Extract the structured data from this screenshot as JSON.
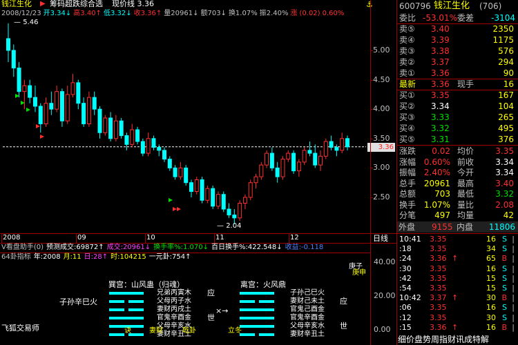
{
  "header": {
    "stock": "钱江生化",
    "indicator": "筹码超跌综合选",
    "price_label": "现价线 3.36",
    "bar_items": [
      {
        "t": "2008/12/23",
        "c": "#c0c0c0"
      },
      {
        "t": "开3.34↓",
        "c": "#00ffff"
      },
      {
        "t": "高3.40↑",
        "c": "#ff3030"
      },
      {
        "t": "低3.32↓",
        "c": "#00ffff"
      },
      {
        "t": "收3.36↑",
        "c": "#ff3030"
      },
      {
        "t": "量20961↓",
        "c": "#c0c0c0"
      },
      {
        "t": "额703↓",
        "c": "#c0c0c0"
      },
      {
        "t": "换1.07%",
        "c": "#c0c0c0"
      },
      {
        "t": "振2.40%",
        "c": "#c0c0c0"
      },
      {
        "t": "涨",
        "c": "#ff3030"
      },
      {
        "t": "(0.02)",
        "c": "#ff3030"
      },
      {
        "t": "0.60%",
        "c": "#ff3030"
      }
    ]
  },
  "chart": {
    "y_ticks": [
      "5.00",
      "4.50",
      "4.00",
      "3.50",
      "3.00",
      "2.50"
    ],
    "months": [
      "2008",
      "09",
      "10",
      "11",
      "12"
    ],
    "high_label": "5.46",
    "low_label": "2.04",
    "current_price": "3.36"
  },
  "chart_data": {
    "type": "candlestick",
    "period": "2008/08 – 2008/12",
    "x_axis_labels": [
      "2008",
      "09",
      "10",
      "11",
      "12"
    ],
    "y_axis_ticks": [
      2.5,
      3.0,
      3.5,
      4.0,
      4.5,
      5.0
    ],
    "annotations": {
      "high": 5.46,
      "low": 2.04,
      "current_price_line": 3.36
    },
    "ohlc": [
      [
        5.2,
        5.46,
        4.8,
        5.0
      ],
      [
        5.0,
        5.1,
        4.55,
        4.7
      ],
      [
        4.7,
        4.8,
        4.2,
        4.3
      ],
      [
        4.3,
        4.5,
        4.0,
        4.4
      ],
      [
        4.4,
        4.5,
        4.1,
        4.2
      ],
      [
        4.2,
        4.4,
        3.95,
        4.05
      ],
      [
        4.05,
        4.1,
        3.6,
        3.75
      ],
      [
        3.75,
        4.2,
        3.7,
        4.1
      ],
      [
        4.1,
        4.3,
        3.9,
        4.0
      ],
      [
        4.0,
        4.4,
        3.95,
        4.3
      ],
      [
        4.3,
        4.35,
        3.7,
        3.8
      ],
      [
        3.8,
        4.4,
        3.75,
        4.25
      ],
      [
        4.25,
        4.6,
        4.2,
        4.45
      ],
      [
        4.45,
        4.5,
        4.0,
        4.1
      ],
      [
        4.1,
        4.2,
        3.7,
        3.75
      ],
      [
        3.75,
        4.3,
        3.7,
        4.2
      ],
      [
        4.2,
        4.3,
        3.9,
        4.0
      ],
      [
        4.0,
        4.05,
        3.5,
        3.6
      ],
      [
        3.6,
        3.9,
        3.55,
        3.85
      ],
      [
        3.85,
        3.95,
        3.45,
        3.5
      ],
      [
        3.5,
        3.9,
        3.45,
        3.8
      ],
      [
        3.8,
        3.85,
        3.5,
        3.55
      ],
      [
        3.55,
        3.6,
        3.3,
        3.4
      ],
      [
        3.4,
        3.75,
        3.35,
        3.65
      ],
      [
        3.65,
        3.7,
        3.4,
        3.45
      ],
      [
        3.45,
        3.5,
        3.2,
        3.25
      ],
      [
        3.25,
        3.6,
        3.2,
        3.5
      ],
      [
        3.5,
        3.55,
        3.3,
        3.35
      ],
      [
        3.35,
        3.4,
        3.2,
        3.3
      ],
      [
        3.3,
        3.35,
        3.1,
        3.15
      ],
      [
        3.15,
        3.2,
        2.95,
        3.0
      ],
      [
        3.0,
        3.05,
        2.8,
        2.85
      ],
      [
        2.85,
        3.1,
        2.8,
        3.0
      ],
      [
        3.0,
        3.05,
        2.7,
        2.75
      ],
      [
        2.75,
        2.8,
        2.5,
        2.6
      ],
      [
        2.6,
        2.85,
        2.55,
        2.8
      ],
      [
        2.8,
        2.85,
        2.4,
        2.45
      ],
      [
        2.45,
        2.7,
        2.4,
        2.65
      ],
      [
        2.65,
        2.7,
        2.3,
        2.35
      ],
      [
        2.35,
        2.6,
        2.3,
        2.55
      ],
      [
        2.55,
        2.6,
        2.25,
        2.3
      ],
      [
        2.3,
        2.4,
        2.15,
        2.2
      ],
      [
        2.2,
        2.3,
        2.04,
        2.15
      ],
      [
        2.15,
        2.45,
        2.1,
        2.4
      ],
      [
        2.4,
        2.55,
        2.3,
        2.5
      ],
      [
        2.5,
        2.8,
        2.45,
        2.75
      ],
      [
        2.75,
        2.9,
        2.65,
        2.85
      ],
      [
        2.85,
        3.1,
        2.8,
        3.05
      ],
      [
        3.05,
        3.3,
        3.0,
        3.25
      ],
      [
        3.25,
        3.35,
        2.95,
        3.0
      ],
      [
        3.0,
        3.1,
        2.75,
        2.85
      ],
      [
        2.85,
        3.2,
        2.8,
        3.15
      ],
      [
        3.15,
        3.3,
        3.1,
        3.25
      ],
      [
        3.25,
        3.3,
        2.9,
        2.95
      ],
      [
        2.95,
        3.15,
        2.85,
        3.1
      ],
      [
        3.1,
        3.35,
        3.05,
        3.3
      ],
      [
        3.3,
        3.45,
        3.2,
        3.25
      ],
      [
        3.25,
        3.4,
        3.0,
        3.05
      ],
      [
        3.05,
        3.3,
        2.95,
        3.2
      ],
      [
        3.2,
        3.5,
        3.15,
        3.45
      ],
      [
        3.45,
        3.55,
        3.3,
        3.35
      ],
      [
        3.35,
        3.4,
        3.2,
        3.3
      ],
      [
        3.3,
        3.6,
        3.25,
        3.5
      ],
      [
        3.5,
        3.55,
        3.3,
        3.36
      ]
    ]
  },
  "indicator_row": {
    "title": "V看盘助手(0)",
    "items": [
      {
        "t": "预测成交:69872↑",
        "c": "#ffffff"
      },
      {
        "t": "成交:20961↓",
        "c": "#ff40ff"
      },
      {
        "t": "换手率%:1.070↓",
        "c": "#00e000"
      },
      {
        "t": "百日换手%:422.548↓",
        "c": "#ffffff"
      },
      {
        "t": "收益:-0.118",
        "c": "#5080ff"
      }
    ]
  },
  "gua_row": {
    "title": "64卦指标",
    "items": [
      {
        "t": "年:2008",
        "c": "#ffffff"
      },
      {
        "t": "月:11",
        "c": "#ffff00"
      },
      {
        "t": "日:28↑",
        "c": "#ff40ff"
      },
      {
        "t": "时:104215",
        "c": "#ffff00"
      },
      {
        "t": "一元卦:754↑",
        "c": "#ffffff"
      }
    ],
    "y_ticks": [
      "40.00",
      "20.00",
      "0.00"
    ],
    "left_gua": {
      "title": "巽宫：山风蛊（归魂）",
      "lines": [
        "兄弟丙寅木",
        "父母丙子水",
        "妻财丙戌土",
        "官鬼辛酉金",
        "父母辛亥水",
        "妻财辛丑土"
      ],
      "yao_yin": [
        false,
        true,
        true,
        false,
        false,
        true
      ],
      "marks": [
        "应",
        "",
        "",
        "世",
        "",
        ""
      ],
      "side": "子孙辛巳火"
    },
    "right_gua": {
      "title": "离宫：火风鼎",
      "lines": [
        "子孙己巳火",
        "妻财己未土",
        "官鬼己酉金",
        "官鬼辛酉金",
        "父母辛亥水",
        "妻财辛丑土"
      ],
      "yao_yin": [
        false,
        true,
        false,
        false,
        false,
        true
      ],
      "marks": [
        "",
        "应",
        "",
        "",
        "世",
        ""
      ]
    },
    "arrow": "×→",
    "bottom_labels": [
      "诀",
      "妻财",
      "乾卦",
      "立冬"
    ],
    "side_text": [
      "庚子",
      "庚申"
    ],
    "author": "飞狐交易师"
  },
  "extra_label": "日线",
  "quote": {
    "code": "600796",
    "name": "钱江生化",
    "rank": "(706)",
    "weibi_label": "委比",
    "weibi": "-53.01%",
    "weicha_label": "委差",
    "weicha": "-3104",
    "sells": [
      {
        "label": "卖⑤",
        "price": "3.40",
        "vol": "2350"
      },
      {
        "label": "卖④",
        "price": "3.39",
        "vol": "1175"
      },
      {
        "label": "卖③",
        "price": "3.38",
        "vol": "576"
      },
      {
        "label": "卖②",
        "price": "3.37",
        "vol": "294"
      },
      {
        "label": "卖①",
        "price": "3.36",
        "vol": "90"
      }
    ],
    "latest_label": "最新",
    "latest": "3.36",
    "now_hand_label": "现手",
    "now_hand": "16",
    "buys": [
      {
        "label": "买①",
        "price": "3.35",
        "vol": "167"
      },
      {
        "label": "买②",
        "price": "3.34",
        "vol": "104"
      },
      {
        "label": "买③",
        "price": "3.33",
        "vol": "265"
      },
      {
        "label": "买④",
        "price": "3.32",
        "vol": "495"
      },
      {
        "label": "买⑤",
        "price": "3.31",
        "vol": "376"
      }
    ],
    "stats": [
      [
        "涨跌",
        "0.02",
        "均价",
        "3.35"
      ],
      [
        "涨幅",
        "0.60%",
        "前收",
        "3.34"
      ],
      [
        "振幅",
        "2.40%",
        "今开",
        "3.34"
      ],
      [
        "总手",
        "20961",
        "最高",
        "3.40"
      ],
      [
        "总额",
        "703",
        "最低",
        "3.32"
      ],
      [
        "换手",
        "1.07%",
        "量比",
        "2.08"
      ],
      [
        "分笔",
        "497",
        "均量",
        "42"
      ]
    ],
    "outer_label": "外盘",
    "outer": "9155",
    "inner_label": "内盘",
    "inner": "11806",
    "ticks": [
      {
        "time": "10:41",
        "price": "3.35",
        "arrow": "",
        "vol": "16",
        "bs": "S"
      },
      {
        "time": ":18",
        "price": "3.35",
        "arrow": "",
        "vol": "34",
        "bs": "S"
      },
      {
        "time": ":24",
        "price": "3.36",
        "arrow": "↑",
        "vol": "65",
        "bs": "B"
      },
      {
        "time": ":30",
        "price": "3.35",
        "arrow": "",
        "vol": "16",
        "bs": "S"
      },
      {
        "time": ":42",
        "price": "3.35",
        "arrow": "",
        "vol": "15",
        "bs": "S"
      },
      {
        "time": ":54",
        "price": "3.35",
        "arrow": "",
        "vol": "15",
        "bs": "S"
      },
      {
        "time": "10:42",
        "price": "3.37",
        "arrow": "↑",
        "vol": "30",
        "bs": "B"
      },
      {
        "time": ":06",
        "price": "3.35",
        "arrow": "",
        "vol": "16",
        "bs": "S"
      },
      {
        "time": ":12",
        "price": "3.35",
        "arrow": "",
        "vol": "30",
        "bs": "S"
      },
      {
        "time": ":15",
        "price": "3.36",
        "arrow": "↑",
        "vol": "16",
        "bs": "B"
      }
    ],
    "bottom_bar": "细价盘势周指财讯成特解"
  }
}
